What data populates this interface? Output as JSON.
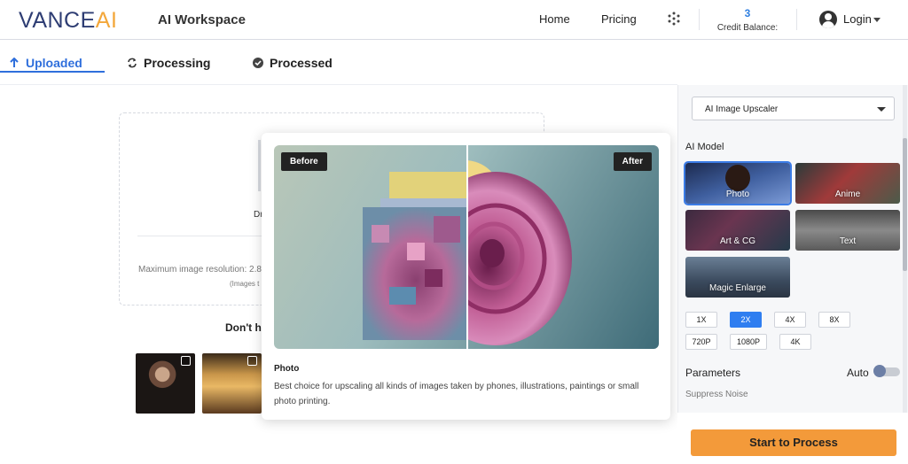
{
  "header": {
    "logo_main": "VANCE",
    "logo_ai": "AI",
    "workspace": "AI Workspace",
    "nav": [
      {
        "label": "Home"
      },
      {
        "label": "Pricing"
      }
    ],
    "apps_icon": "grid-dots-icon",
    "credit_value": "3",
    "credit_label": "Credit Balance:",
    "login_label": "Login"
  },
  "tabs": [
    {
      "label": "Uploaded",
      "icon": "arrow-up-icon",
      "active": true
    },
    {
      "label": "Processing",
      "icon": "refresh-icon",
      "active": false
    },
    {
      "label": "Processed",
      "icon": "check-circle-icon",
      "active": false
    }
  ],
  "upload": {
    "drop_text": "Dr",
    "max_resolution": "Maximum image resolution: 2.8",
    "note": "(Images t",
    "samples_heading": "Don't h"
  },
  "popup": {
    "before_label": "Before",
    "after_label": "After",
    "title": "Photo",
    "description": "Best choice for upscaling all kinds of images taken by phones, illustrations, paintings or small photo printing."
  },
  "sidebar": {
    "tool_select": "AI Image Upscaler",
    "model_heading": "AI Model",
    "models": [
      {
        "label": "Photo",
        "selected": true
      },
      {
        "label": "Anime",
        "selected": false
      },
      {
        "label": "Art & CG",
        "selected": false
      },
      {
        "label": "Text",
        "selected": false
      },
      {
        "label": "Magic Enlarge",
        "selected": false
      }
    ],
    "scales": [
      {
        "label": "1X",
        "active": false
      },
      {
        "label": "2X",
        "active": true
      },
      {
        "label": "4X",
        "active": false
      },
      {
        "label": "8X",
        "active": false
      },
      {
        "label": "720P",
        "active": false
      },
      {
        "label": "1080P",
        "active": false
      },
      {
        "label": "4K",
        "active": false
      }
    ],
    "parameters_label": "Parameters",
    "auto_label": "Auto",
    "auto_enabled": false,
    "suppress_noise_label": "Suppress Noise",
    "process_button": "Start to Process"
  },
  "colors": {
    "brand_navy": "#2e3d73",
    "brand_orange": "#f3a73a",
    "accent_blue": "#2f6fdc",
    "process_orange": "#f39a3a"
  }
}
